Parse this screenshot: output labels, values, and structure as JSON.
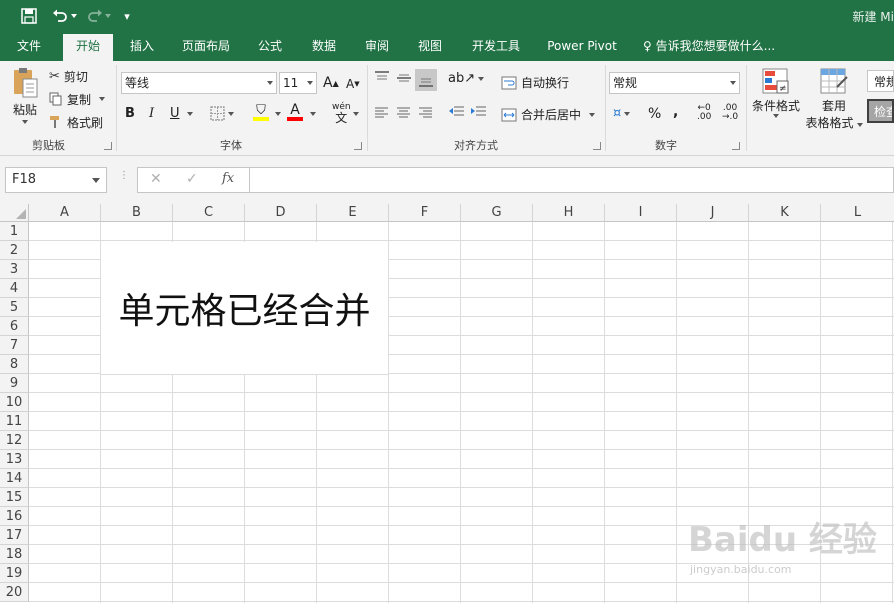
{
  "titlebar": {
    "doc_title": "新建 Mi",
    "qa_more": "▾"
  },
  "tabs": [
    "文件",
    "开始",
    "插入",
    "页面布局",
    "公式",
    "数据",
    "审阅",
    "视图",
    "开发工具",
    "Power Pivot"
  ],
  "tell_me": "告诉我您想要做什么...",
  "clipboard": {
    "paste": "粘贴",
    "cut": "剪切",
    "copy": "复制",
    "format_painter": "格式刷",
    "group_label": "剪贴板"
  },
  "font": {
    "name": "等线",
    "size": "11",
    "grow": "A",
    "shrink": "A",
    "bold": "B",
    "italic": "I",
    "underline": "U",
    "phonetic": "wén",
    "group_label": "字体",
    "colors": {
      "fill": "#ffff00",
      "font": "#ff0000"
    }
  },
  "alignment": {
    "wrap": "自动换行",
    "merge": "合并后居中",
    "group_label": "对齐方式"
  },
  "number": {
    "format": "常规",
    "percent": "%",
    "comma": ",",
    "inc_decimal_top": "←0",
    "inc_decimal_bottom": ".00",
    "dec_decimal_top": ".00",
    "dec_decimal_bottom": "→.0",
    "group_label": "数字"
  },
  "styles": {
    "conditional": "条件格式",
    "table_line1": "套用",
    "table_line2": "表格格式",
    "style_normal": "常規",
    "style_check": "检查"
  },
  "formula_bar": {
    "name_box": "F18",
    "cancel": "✕",
    "enter": "✓",
    "fx": "fx",
    "formula": ""
  },
  "sheet": {
    "columns": [
      "A",
      "B",
      "C",
      "D",
      "E",
      "F",
      "G",
      "H",
      "I",
      "J",
      "K",
      "L"
    ],
    "rows": [
      "1",
      "2",
      "3",
      "4",
      "5",
      "6",
      "7",
      "8",
      "9",
      "10",
      "11",
      "12",
      "13",
      "14",
      "15",
      "16",
      "17",
      "18",
      "19",
      "20"
    ],
    "merged_text": "单元格已经合并"
  },
  "watermark": {
    "brand": "Baidu 经验",
    "url": "jingyan.baidu.com"
  },
  "accent": "#217346"
}
